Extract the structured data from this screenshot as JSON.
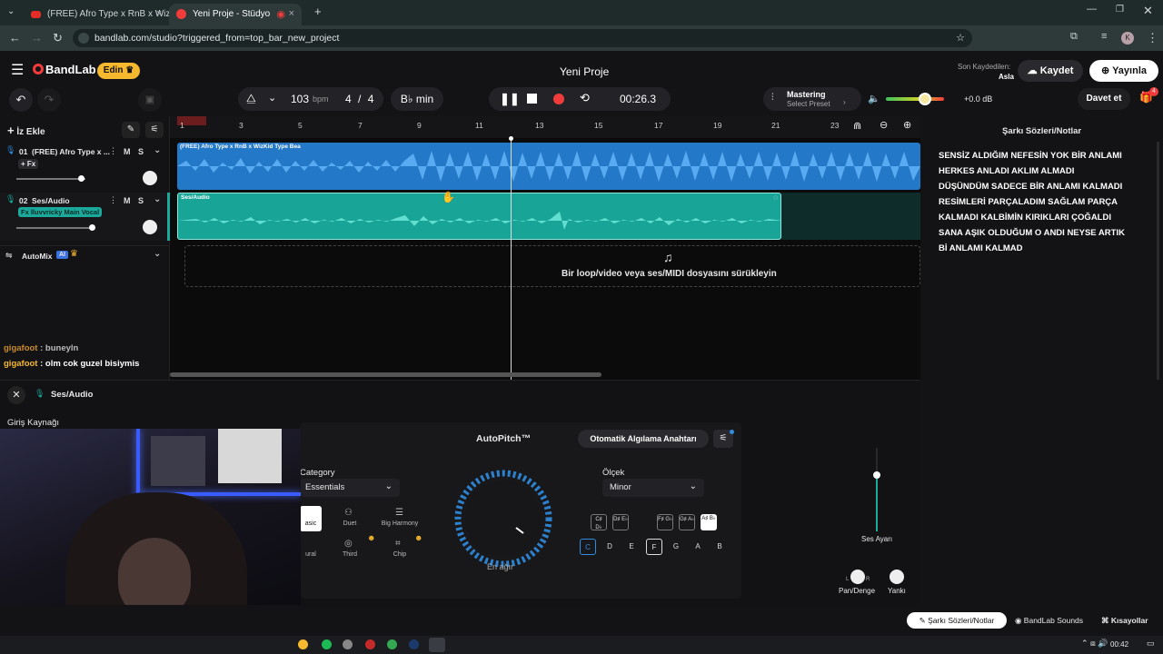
{
  "browser": {
    "tabs": [
      {
        "label": "(FREE) Afro Type x RnB x WizKid"
      },
      {
        "label": "Yeni Proje - Stüdyo"
      }
    ],
    "url": "bandlab.com/studio?triggered_from=top_bar_new_project",
    "profile_initial": "K"
  },
  "header": {
    "logo": "BandLab",
    "edit_label": "Edin",
    "title": "Yeni Proje",
    "last_saved_label": "Son Kaydedilen:",
    "last_saved_value": "Asla",
    "save_label": "Kaydet",
    "publish_label": "Yayınla"
  },
  "toolbar": {
    "bpm_value": "103",
    "bpm_unit": "bpm",
    "time_sig_num": "4",
    "time_sig_slash": "/",
    "time_sig_den": "4",
    "key": "B♭ min",
    "time": "00:26.3",
    "mastering_label": "Mastering",
    "mastering_preset": "Select Preset",
    "volume_db": "+0.0 dB",
    "invite_label": "Davet et",
    "gift_badge": "4"
  },
  "tracklist": {
    "add_track_label": "İz Ekle",
    "tracks": [
      {
        "number": "01",
        "name": "(FREE) Afro Type x ...",
        "fx_label": "+ Fx",
        "mute": "M",
        "solo": "S"
      },
      {
        "number": "02",
        "name": "Ses/Audio",
        "fx_label": "Fx lluvvricky Main Vocal",
        "mute": "M",
        "solo": "S"
      }
    ],
    "automix_label": "AutoMix",
    "ai_badge": "AI",
    "chat": [
      {
        "user": "gigafoot",
        "message": " : buneyln"
      },
      {
        "user": "gigafoot",
        "message": " : olm cok guzel bisiymis"
      }
    ]
  },
  "arrangement": {
    "ruler_numbers": [
      "1",
      "3",
      "5",
      "7",
      "9",
      "11",
      "13",
      "15",
      "17",
      "19",
      "21",
      "23"
    ],
    "clip1_label": "(FREE) Afro Type x RnB x WizKid Type Bea",
    "clip2_label": "Ses/Audio",
    "drop_hint": "Bir loop/video veya ses/MIDI dosyasını sürükleyin"
  },
  "lyrics": {
    "title": "Şarkı Sözleri/Notlar",
    "lines": [
      "SENSİZ ALDIĞIM NEFESİN YOK BİR ANLAMI",
      "HERKES ANLADI AKLIM ALMADI",
      "DÜŞÜNDÜM SADECE BİR ANLAMI KALMADI",
      "RESİMLERİ PARÇALADIM SAĞLAM PARÇA",
      "KALMADI KALBİMİN KIRIKLARI ÇOĞALDI",
      "SANA AŞIK OLDUĞUM O ANDI NEYSE ARTIK",
      "Bİ ANLAMI KALMAD"
    ]
  },
  "editor": {
    "track_label": "Ses/Audio",
    "input_source_label": "Giriş Kaynağı",
    "autopitch_title": "AutoPitch™",
    "auto_detect_label": "Otomatik Algılama Anahtarı",
    "category_label": "Category",
    "category_value": "Essentials",
    "presets": [
      "asic",
      "Duet",
      "Big Harmony",
      "ural",
      "Third",
      "Chip"
    ],
    "knob_caption": "En ağır",
    "scale_label": "Ölçek",
    "scale_value": "Minor",
    "sharp_keys": [
      "C♯ D♭",
      "D♯ E♭",
      "F♯ G♭",
      "G♯ A♭",
      "A♯ B♭"
    ],
    "natural_keys": [
      "C",
      "D",
      "E",
      "F",
      "G",
      "A",
      "B"
    ],
    "volume_label": "Ses Ayarı",
    "pan_label": "Pan/Denge",
    "echo_label": "Yankı",
    "pan_l": "L",
    "pan_r": "R"
  },
  "footer": {
    "lyrics_tab": "Şarkı Sözleri/Notlar",
    "sounds_tab": "BandLab Sounds",
    "shortcuts_tab": "Kısayollar"
  },
  "taskbar": {
    "clock": "00:42"
  },
  "colors": {
    "accent_blue": "#2f8ce0",
    "accent_teal": "#1aa99a",
    "brand_red": "#f23c3c",
    "yellow": "#f5b82e"
  }
}
